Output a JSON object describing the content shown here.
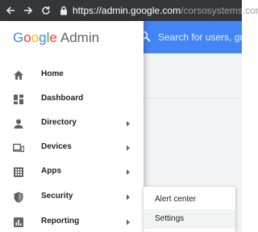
{
  "browser": {
    "url_host": "https://admin.google.com",
    "url_path": "/corsosystems.com/"
  },
  "logo": {
    "letters": [
      "G",
      "o",
      "o",
      "g",
      "l",
      "e"
    ],
    "product": "Admin"
  },
  "search": {
    "placeholder": "Search for users, group"
  },
  "sidebar": {
    "items": [
      {
        "label": "Home",
        "icon": "home-icon",
        "has_submenu": false
      },
      {
        "label": "Dashboard",
        "icon": "dashboard-icon",
        "has_submenu": false
      },
      {
        "label": "Directory",
        "icon": "person-icon",
        "has_submenu": true
      },
      {
        "label": "Devices",
        "icon": "devices-icon",
        "has_submenu": true
      },
      {
        "label": "Apps",
        "icon": "apps-grid-icon",
        "has_submenu": true
      },
      {
        "label": "Security",
        "icon": "shield-icon",
        "has_submenu": true
      },
      {
        "label": "Reporting",
        "icon": "bar-chart-icon",
        "has_submenu": true
      }
    ]
  },
  "security_menu": {
    "options": [
      "Alert center",
      "Settings"
    ],
    "highlighted": "Settings"
  },
  "colors": {
    "chrome_bg": "#35363a",
    "appbar": "#4285f4",
    "icon_gray": "#5f6368"
  }
}
